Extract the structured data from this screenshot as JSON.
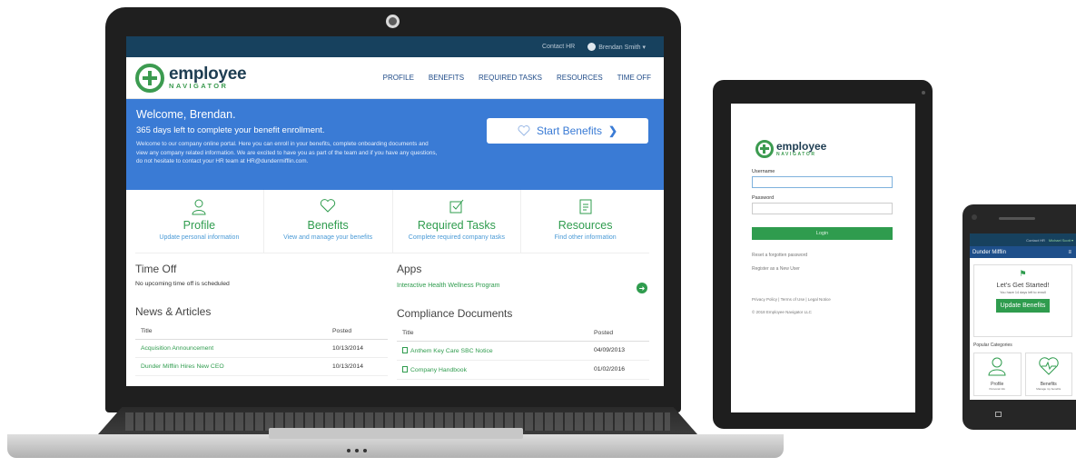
{
  "laptop": {
    "topbar": {
      "contact": "Contact HR",
      "user": "Brendan Smith ▾"
    },
    "logo": {
      "line1": "employee",
      "line2": "NAVIGATOR"
    },
    "nav": [
      "PROFILE",
      "BENEFITS",
      "REQUIRED TASKS",
      "RESOURCES",
      "TIME OFF"
    ],
    "hero": {
      "welcome": "Welcome, Brendan.",
      "days_left": "365 days left to complete your benefit enrollment.",
      "message": "Welcome to our company online portal. Here you can enroll in your benefits, complete onboarding documents and view any company related information. We are excited to have you as part of the team and if you have any questions, do not hesitate to contact your HR team at HR@dundermifflin.com.",
      "start_button": "Start Benefits"
    },
    "tiles": [
      {
        "title": "Profile",
        "subtitle": "Update personal information",
        "icon": "user-icon"
      },
      {
        "title": "Benefits",
        "subtitle": "View and manage your benefits",
        "icon": "heart-icon"
      },
      {
        "title": "Required Tasks",
        "subtitle": "Complete required company tasks",
        "icon": "checklist-icon"
      },
      {
        "title": "Resources",
        "subtitle": "Find other information",
        "icon": "document-icon"
      }
    ],
    "time_off": {
      "title": "Time Off",
      "text": "No upcoming time off is scheduled"
    },
    "apps": {
      "title": "Apps",
      "link": "Interactive Health Wellness Program"
    },
    "news": {
      "title": "News & Articles",
      "col_title": "Title",
      "col_posted": "Posted",
      "rows": [
        {
          "title": "Acquisition Announcement",
          "posted": "10/13/2014"
        },
        {
          "title": "Dunder Mifflin Hires New CEO",
          "posted": "10/13/2014"
        }
      ]
    },
    "compliance": {
      "title": "Compliance Documents",
      "col_title": "Title",
      "col_posted": "Posted",
      "rows": [
        {
          "title": "Anthem Key Care SBC Notice",
          "posted": "04/09/2013"
        },
        {
          "title": "Company Handbook",
          "posted": "01/02/2016"
        }
      ]
    }
  },
  "tablet": {
    "logo": {
      "line1": "employee",
      "line2": "NAVIGATOR"
    },
    "username_label": "Username",
    "password_label": "Password",
    "login_button": "Login",
    "reset_link": "Reset a forgotten password",
    "register_link": "Register as a New User",
    "footer": "Privacy Policy | Terms of Use | Legal Notice",
    "copyright": "© 2018 Employee Navigator LLC"
  },
  "phone": {
    "topbar": {
      "contact": "Contact HR",
      "user": "Michael Scott ▾"
    },
    "company": "Dunder Mifflin",
    "menu": "≡",
    "card_title": "Let's Get Started!",
    "card_sub": "You have 14 days left to enroll",
    "card_button": "Update Benefits",
    "popular": "Popular Categories",
    "cats": [
      {
        "name": "Profile",
        "desc": "Personal info"
      },
      {
        "name": "Benefits",
        "desc": "Manage my benefits"
      }
    ]
  },
  "colors": {
    "navy": "#17415e",
    "blue": "#3a7bd5",
    "green": "#2f9c4e"
  }
}
